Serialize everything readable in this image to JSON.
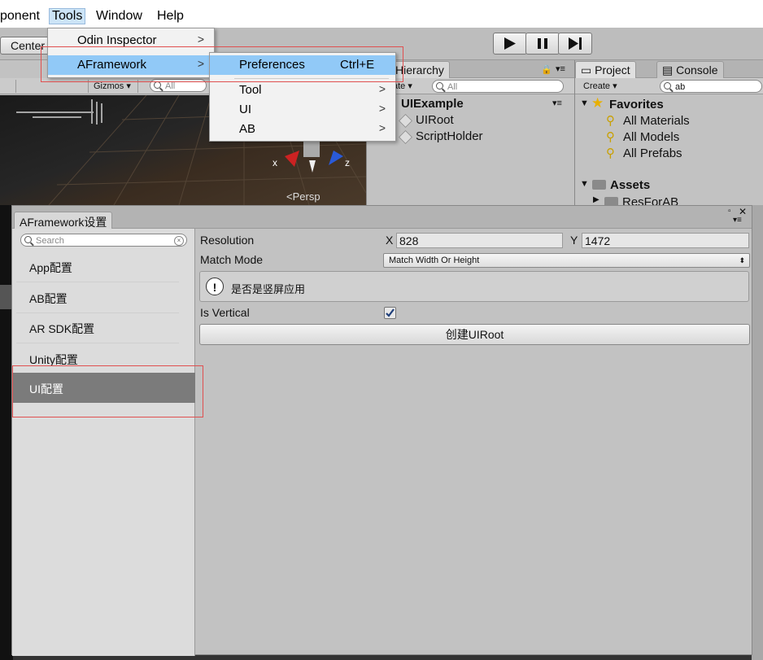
{
  "menubar": {
    "items": [
      "ponent",
      "Tools",
      "Window",
      "Help"
    ]
  },
  "tools_menu": {
    "items": [
      {
        "label": "Odin Inspector"
      },
      {
        "label": "AFramework"
      }
    ],
    "submenu": [
      {
        "label": "Preferences",
        "shortcut": "Ctrl+E"
      },
      {
        "label": "Tool"
      },
      {
        "label": "UI"
      },
      {
        "label": "AB"
      }
    ]
  },
  "scene": {
    "center_label": "Center",
    "gizmos_label": "Gizmos",
    "search_placeholder": "All",
    "persp_label": "Persp",
    "axis_x": "x",
    "axis_z": "z"
  },
  "hierarchy": {
    "tab_label": "Hierarchy",
    "create_label": "ate",
    "search_placeholder": "All",
    "root": "UIExample",
    "children": [
      "UIRoot",
      "ScriptHolder"
    ]
  },
  "project": {
    "tab_project": "Project",
    "tab_console": "Console",
    "create_label": "Create",
    "search_value": "ab",
    "favorites_label": "Favorites",
    "favorites": [
      "All Materials",
      "All Models",
      "All Prefabs"
    ],
    "assets_label": "Assets",
    "assets_child": "ResForAB"
  },
  "settings_window": {
    "tab_title": "AFramework设置",
    "search_placeholder": "Search",
    "sidebar_items": [
      "App配置",
      "AB配置",
      "AR SDK配置",
      "Unity配置",
      "UI配置"
    ],
    "selected_index": 4,
    "resolution_label": "Resolution",
    "x_label": "X",
    "x_value": "828",
    "y_label": "Y",
    "y_value": "1472",
    "match_mode_label": "Match Mode",
    "match_mode_value": "Match Width Or Height",
    "info_text": "是否是竖屏应用",
    "is_vertical_label": "Is Vertical",
    "is_vertical_checked": true,
    "create_button_label": "创建UIRoot"
  },
  "colors": {
    "highlight": "#91c9f7",
    "annotation": "#e05050",
    "selected_item": "#7b7b7b"
  }
}
